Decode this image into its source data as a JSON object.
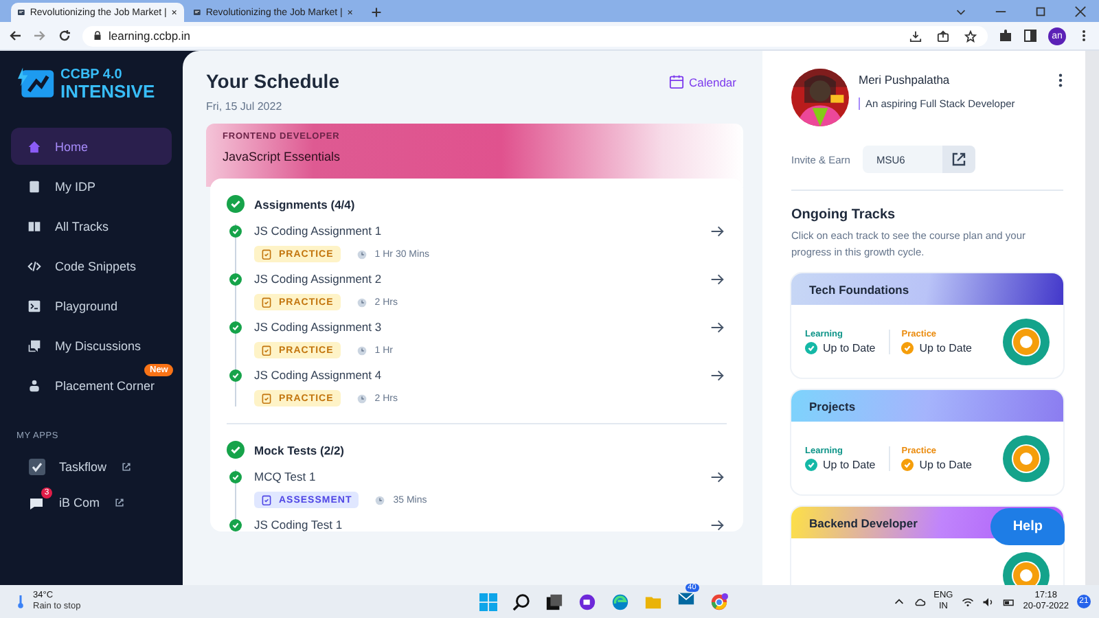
{
  "browser": {
    "tabs": [
      {
        "title": "Revolutionizing the Job Market |",
        "selected": true
      },
      {
        "title": "Revolutionizing the Job Market |",
        "selected": false
      }
    ],
    "url": "learning.ccbp.in",
    "profile": "an"
  },
  "sidebar": {
    "logo_top": "CCBP 4.0",
    "logo_bottom": "INTENSIVE",
    "items": [
      {
        "label": "Home",
        "selected": true
      },
      {
        "label": "My IDP",
        "selected": false
      },
      {
        "label": "All Tracks",
        "selected": false
      },
      {
        "label": "Code Snippets",
        "selected": false
      },
      {
        "label": "Playground",
        "selected": false
      },
      {
        "label": "My Discussions",
        "selected": false
      },
      {
        "label": "Placement Corner",
        "selected": false,
        "badge": "New"
      }
    ],
    "apps_heading": "MY APPS",
    "apps": [
      {
        "label": "Taskflow"
      },
      {
        "label": "iB Com",
        "badge": "3"
      }
    ]
  },
  "schedule": {
    "title": "Your Schedule",
    "date": "Fri, 15 Jul 2022",
    "calendar": "Calendar",
    "banner": {
      "eyebrow": "FRONTEND DEVELOPER",
      "course": "JavaScript Essentials"
    },
    "sections": [
      {
        "title": "Assignments (4/4)",
        "done": true,
        "items": [
          {
            "title": "JS Coding Assignment 1",
            "done": true,
            "tag": {
              "kind": "practice",
              "label": "PRACTICE"
            },
            "duration": "1 Hr 30 Mins"
          },
          {
            "title": "JS Coding Assignment 2",
            "done": true,
            "tag": {
              "kind": "practice",
              "label": "PRACTICE"
            },
            "duration": "2 Hrs"
          },
          {
            "title": "JS Coding Assignment 3",
            "done": true,
            "tag": {
              "kind": "practice",
              "label": "PRACTICE"
            },
            "duration": "1 Hr"
          },
          {
            "title": "JS Coding Assignment 4",
            "done": true,
            "tag": {
              "kind": "practice",
              "label": "PRACTICE"
            },
            "duration": "2 Hrs"
          }
        ]
      },
      {
        "title": "Mock Tests (2/2)",
        "done": true,
        "items": [
          {
            "title": "MCQ Test 1",
            "done": true,
            "tag": {
              "kind": "assessment",
              "label": "ASSESSMENT"
            },
            "duration": "35 Mins"
          },
          {
            "title": "JS Coding Test 1",
            "done": true
          }
        ]
      }
    ]
  },
  "profile": {
    "name": "Meri Pushpalatha",
    "bio": "An aspiring Full Stack Developer",
    "invite_label": "Invite & Earn",
    "invite_code": "MSU6"
  },
  "tracks": {
    "title": "Ongoing Tracks",
    "hint": "Click on each track to see the course plan and your progress in this growth cycle.",
    "items": [
      {
        "name": "Tech Foundations",
        "learning_label": "Learning",
        "learning_status": "Up to Date",
        "practice_label": "Practice",
        "practice_status": "Up to Date"
      },
      {
        "name": "Projects",
        "learning_label": "Learning",
        "learning_status": "Up to Date",
        "practice_label": "Practice",
        "practice_status": "Up to Date"
      },
      {
        "name": "Backend Developer"
      }
    ]
  },
  "help": "Help",
  "taskbar": {
    "temperature": "34°C",
    "weather": "Rain to stop",
    "mail_badge": "40",
    "lang": "ENG",
    "region": "IN",
    "time": "17:18",
    "date": "20-07-2022",
    "notifications": "21"
  }
}
